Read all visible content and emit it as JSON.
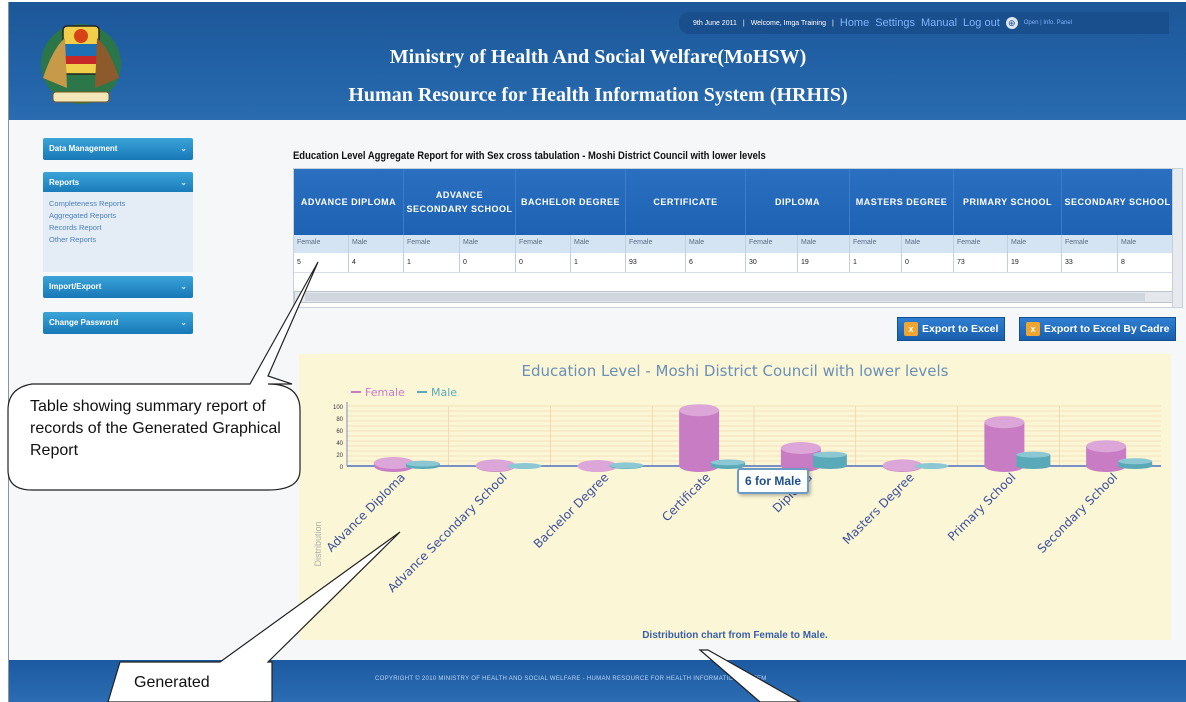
{
  "header": {
    "title_line1": "Ministry of Health And Social Welfare(MoHSW)",
    "title_line2": "Human Resource for Health Information System (HRHIS)",
    "date": "9th June 2011",
    "welcome": "Welcome, Imga Training",
    "nav": [
      "Home",
      "Settings",
      "Manual",
      "Log out"
    ],
    "panel_link": "Open | Info. Panel"
  },
  "sidebar": {
    "data_management": "Data Management",
    "reports": "Reports",
    "report_items": [
      "Completeness Reports",
      "Aggregated Reports",
      "Records Report",
      "Other Reports"
    ],
    "import_export": "Import/Export",
    "change_password": "Change Password"
  },
  "report": {
    "title": "Education Level Aggregate Report for with Sex cross tabulation - Moshi District Council with lower levels",
    "columns": [
      "ADVANCE DIPLOMA",
      "ADVANCE SECONDARY SCHOOL",
      "BACHELOR DEGREE",
      "CERTIFICATE",
      "DIPLOMA",
      "MASTERS DEGREE",
      "PRIMARY SCHOOL",
      "SECONDARY SCHOOL"
    ],
    "sub_columns": [
      "Female",
      "Male"
    ],
    "values": [
      [
        "5",
        "4"
      ],
      [
        "1",
        "0"
      ],
      [
        "0",
        "1"
      ],
      [
        "93",
        "6"
      ],
      [
        "30",
        "19"
      ],
      [
        "1",
        "0"
      ],
      [
        "73",
        "19"
      ],
      [
        "33",
        "8"
      ]
    ]
  },
  "buttons": {
    "export_excel": "Export to Excel",
    "export_cadre": "Export to Excel By Cadre"
  },
  "chart_data": {
    "type": "bar",
    "title": "Education Level - Moshi District Council with lower levels",
    "subtitle": "Distribution chart from Female to Male.",
    "ylabel": "Distribution",
    "categories": [
      "Advance Diploma",
      "Advance Secondary School",
      "Bachelor Degree",
      "Certificate",
      "Diploma",
      "Masters Degree",
      "Primary School",
      "Secondary School"
    ],
    "series": [
      {
        "name": "Female",
        "values": [
          5,
          1,
          0,
          93,
          30,
          1,
          73,
          33
        ],
        "color": "#c77cc4"
      },
      {
        "name": "Male",
        "values": [
          4,
          0,
          1,
          6,
          19,
          0,
          19,
          8
        ],
        "color": "#5aa9b8"
      }
    ],
    "legend": "top-left",
    "ylim": [
      0,
      100
    ],
    "y_ticks": [
      "100",
      "80",
      "60",
      "40",
      "20",
      "0"
    ]
  },
  "tooltip": "6 for Male",
  "footer": "COPYRIGHT © 2010 MINISTRY OF HEALTH AND SOCIAL WELFARE - HUMAN RESOURCE FOR HEALTH INFORMATION SYSTEM",
  "callouts": {
    "table_note": "Table showing summary report of records of the Generated Graphical Report",
    "generated_note": "Generated"
  }
}
